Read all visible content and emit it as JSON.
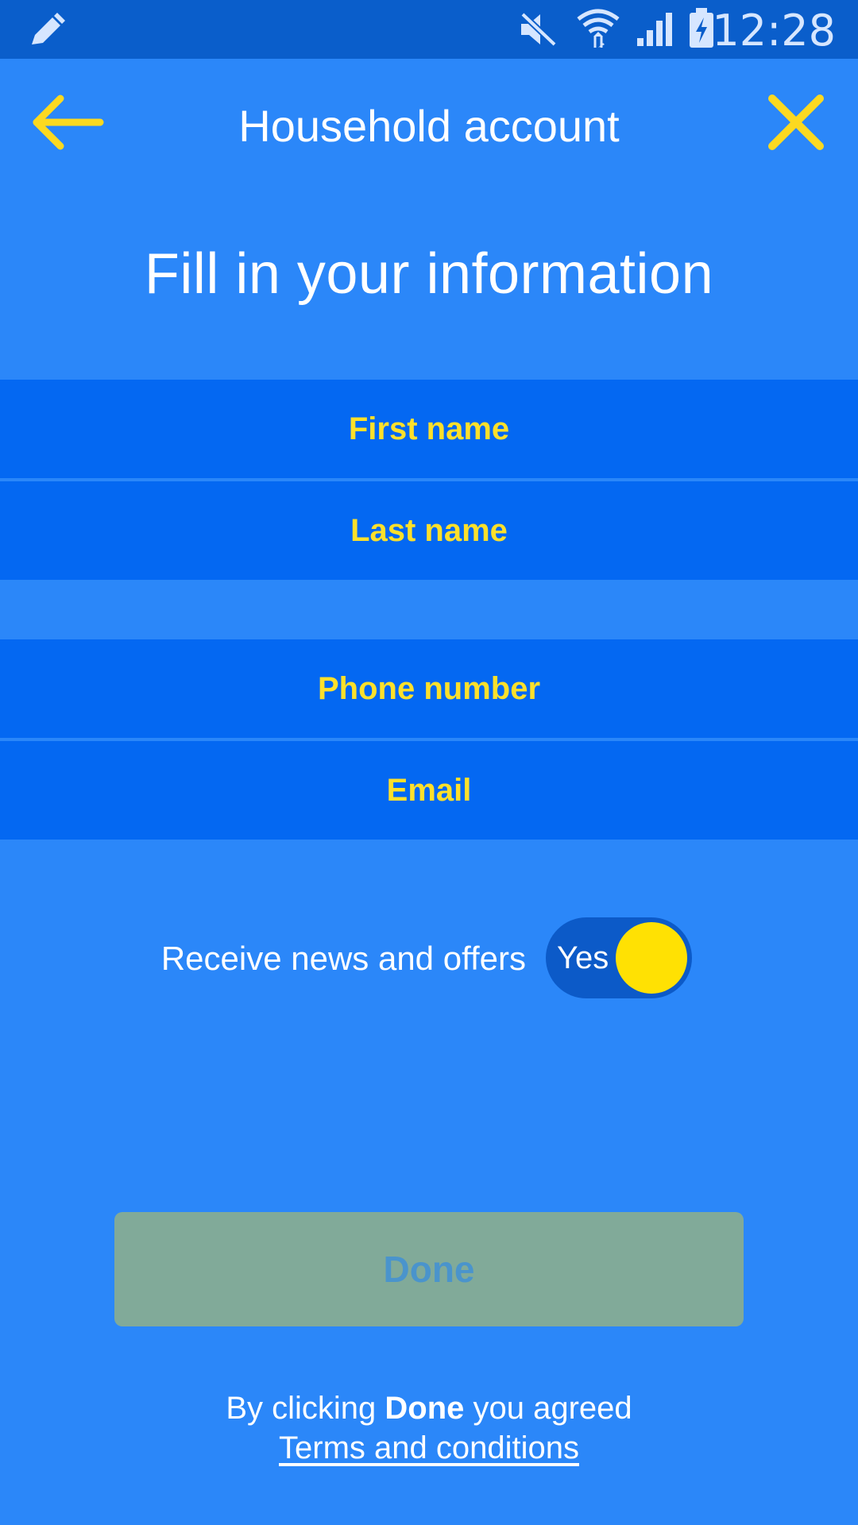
{
  "status_bar": {
    "time": "12:28",
    "icons": [
      "edit-pencil-icon",
      "muted-icon",
      "wifi-icon",
      "signal-icon",
      "battery-charging-icon"
    ]
  },
  "app_bar": {
    "title": "Household account",
    "back_icon": "arrow-left-icon",
    "close_icon": "close-icon"
  },
  "headline": "Fill in your information",
  "fields": {
    "first_name": {
      "placeholder": "First name",
      "value": ""
    },
    "last_name": {
      "placeholder": "Last name",
      "value": ""
    },
    "phone": {
      "placeholder": "Phone number",
      "value": ""
    },
    "email": {
      "placeholder": "Email",
      "value": ""
    }
  },
  "newsletter": {
    "label": "Receive news and offers",
    "toggle_text": "Yes",
    "enabled": true
  },
  "done_label": "Done",
  "footer": {
    "prefix": "By clicking ",
    "bold": "Done",
    "suffix": " you agreed",
    "link": "Terms and conditions"
  },
  "colors": {
    "background": "#2b87f9",
    "status_bar": "#0a5ecb",
    "field": "#0468f2",
    "accent_yellow": "#fde02b",
    "done_disabled": "#81aa99",
    "toggle_track": "#0c5ac8"
  }
}
